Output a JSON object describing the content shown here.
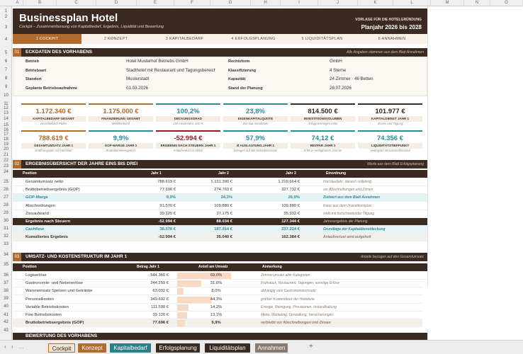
{
  "columns": [
    "A",
    "B",
    "C",
    "D",
    "E",
    "F",
    "G",
    "H",
    "I",
    "J",
    "K",
    "L",
    "M",
    "N",
    "O"
  ],
  "rows": [
    "1",
    "2",
    "3",
    "4",
    "5",
    "6",
    "7",
    "8",
    "9",
    "10",
    "11",
    "12",
    "13",
    "14",
    "15",
    "16",
    "17",
    "18",
    "19",
    "20",
    "21",
    "22",
    "23",
    "24",
    "25",
    "26",
    "27",
    "28",
    "29",
    "30",
    "31",
    "32",
    "33",
    "34",
    "35",
    "36",
    "37",
    "38",
    "39",
    "40",
    "41",
    "42",
    "43"
  ],
  "banner": {
    "title": "Businessplan Hotel",
    "subtitle": "Cockpit – Zusammenfassung von Kapitalbedarf, Ergebnis, Liquidität und Bewertung",
    "template_label": "VORLAGE FÜR DIE HOTELGRÜNDUNG",
    "plan_years": "Planjahr 2026 bis 2028"
  },
  "nav": [
    "1 COCKPIT",
    "2 KONZEPT",
    "3 KAPITALBEDARF",
    "4 ERFOLGSPLANUNG",
    "5 LIQUIDITÄTSPLAN",
    "6 ANNAHMEN"
  ],
  "section1": {
    "num": "01",
    "title": "ECKDATEN DES VORHABENS",
    "note": "Alle Angaben stammen aus dem Blatt Annahmen",
    "left": [
      {
        "label": "Betrieb",
        "value": "Hotel Musterhof Betriebs GmbH"
      },
      {
        "label": "Betriebsart",
        "value": "Stadthotel mit Restaurant und Tagungsbereich"
      },
      {
        "label": "Standort",
        "value": "Musterstadt"
      },
      {
        "label": "Geplante Betriebsaufnahme",
        "value": "01.03.2026"
      }
    ],
    "right": [
      {
        "label": "Rechtsform",
        "value": "GmbH"
      },
      {
        "label": "Klassifizierung",
        "value": "4 Sterne"
      },
      {
        "label": "Kapazität",
        "value": "24 Zimmer · 46 Betten"
      },
      {
        "label": "Stand der Planung",
        "value": "28.07.2026"
      }
    ]
  },
  "kpis_row1": [
    {
      "value": "1.172.340 €",
      "label": "KAPITALBEDARF GESAMT",
      "sub": "einschließlich Puffer",
      "color": "#b06b2e"
    },
    {
      "value": "1.175.000 €",
      "label": "FINANZIERUNG GESAMT",
      "sub": "Mittelherkunft",
      "color": "#b06b2e"
    },
    {
      "value": "100,2%",
      "label": "DECKUNGSGRAD",
      "sub": "Ziel mindestens 100 %",
      "color": "#2d8a9b"
    },
    {
      "value": "23,8%",
      "label": "EIGENKAPITALQUOTE",
      "sub": "Ziel laut Annahmen",
      "color": "#2d8a9b"
    },
    {
      "value": "814.500 €",
      "label": "INVESTITIONSVOLUMEN",
      "sub": "Anlagevermögen netto",
      "color": "#3a2a21"
    },
    {
      "value": "101.977 €",
      "label": "KAPITALDIENST JAHR 1",
      "sub": "Zinsen und Tilgung",
      "color": "#3a2a21"
    }
  ],
  "kpis_row2": [
    {
      "value": "788.619 €",
      "label": "GESAMTUMSATZ JAHR 1",
      "sub": "Eröffnungsjahr mit Hochlauf",
      "color": "#b06b2e"
    },
    {
      "value": "9,9%",
      "label": "GOP-MARGE JAHR 1",
      "sub": "Bruttobetriebsergebnis",
      "color": "#2d8a9b"
    },
    {
      "value": "-52.994 €",
      "label": "ERGEBNIS NACH STEUERN JAHR 1",
      "sub": "Anlaufverlust ist üblich",
      "color": "#8a1f2b"
    },
    {
      "value": "57,9%",
      "label": "Ø AUSLASTUNG JAHR 1",
      "sub": "bezogen auf alle Betriebsmonate",
      "color": "#2d8a9b"
    },
    {
      "value": "74,12 €",
      "label": "REVPAR JAHR 1",
      "sub": "Erlös je verfügbarem Zimmer",
      "color": "#2d8a9b"
    },
    {
      "value": "74.356 €",
      "label": "LIQUIDITÄTSTIEFPUNKT",
      "sub": "niedrigster Monatsendbestand",
      "color": "#2d8a9b"
    }
  ],
  "section2": {
    "num": "02",
    "title": "ERGEBNISÜBERSICHT DER JAHRE EINS BIS DREI",
    "note": "Werte aus dem Blatt Erfolgsplanung",
    "headers": [
      "Position",
      "Jahr 1",
      "Jahr 2",
      "Jahr 3",
      "Einordnung"
    ],
    "rows": [
      {
        "label": "Gesamtumsatz netto",
        "y1": "788.619 €",
        "y2": "1.131.390 €",
        "y3": "1.219.664 €",
        "note": "Hochlaufjahr, danach volljährig",
        "style": ""
      },
      {
        "label": "Bruttobetriebsergebnis (GOP)",
        "y1": "77.696 €",
        "y2": "274.763 €",
        "y3": "327.732 €",
        "note": "vor Abschreibungen und Zinsen",
        "style": ""
      },
      {
        "label": "GOP-Marge",
        "y1": "9,9%",
        "y2": "24,3%",
        "y3": "26,9%",
        "note": "Zielwert aus dem Blatt Annahmen",
        "style": "hl"
      },
      {
        "label": "Abschreibungen",
        "y1": "91.570 €",
        "y2": "109.880 €",
        "y3": "109.880 €",
        "note": "linear aus dem Investitionsplan",
        "style": ""
      },
      {
        "label": "Zinsaufwand",
        "y1": "39.120 €",
        "y2": "37.175 €",
        "y3": "35.932 €",
        "note": "sinkt mit fortschreitender Tilgung",
        "style": ""
      },
      {
        "label": "Ergebnis nach Steuern",
        "y1": "-52.994 €",
        "y2": "88.034 €",
        "y3": "127.344 €",
        "note": "Jahresergebnis der Planung",
        "style": "dark"
      },
      {
        "label": "Cashflow",
        "y1": "38.576 €",
        "y2": "197.914 €",
        "y3": "237.224 €",
        "note": "Grundlage der Kapitaldienstdeckung",
        "style": "hl"
      },
      {
        "label": "Kumuliertes Ergebnis",
        "y1": "-52.994 €",
        "y2": "35.040 €",
        "y3": "162.384 €",
        "note": "Anlaufverlust wird aufgeholt",
        "style": "gray"
      }
    ]
  },
  "section3": {
    "num": "03",
    "title": "UMSATZ- UND KOSTENSTRUKTUR IM JAHR 1",
    "note": "Anteile bezogen auf den Gesamtumsatz",
    "headers": [
      "Position",
      "Betrag Jahr 1",
      "Anteil am Umsatz",
      "Anmerkung"
    ],
    "rows": [
      {
        "label": "Logiserlöse",
        "amount": "544.360 €",
        "share": "69,0%",
        "pct": 69.0,
        "note": "Zimmerumsatz aller Kategorien",
        "style": ""
      },
      {
        "label": "Gastronomie- und Nebenerlöse",
        "amount": "244.259 €",
        "share": "31,0%",
        "pct": 31.0,
        "note": "Frühstück, Restaurant, Tagungen, sonstige Erlöse",
        "style": ""
      },
      {
        "label": "Wareneinsatz Speisen und Getränke",
        "amount": "63.032 €",
        "share": "8,0%",
        "pct": 8.0,
        "note": "abhängig vom Gastronomieumsatz",
        "style": ""
      },
      {
        "label": "Personalkosten",
        "amount": "349.692 €",
        "share": "44,3%",
        "pct": 44.3,
        "note": "größter Kostenblock der Hotellerie",
        "style": ""
      },
      {
        "label": "Variable Betriebskosten",
        "amount": "111.599 €",
        "share": "14,2%",
        "pct": 14.2,
        "note": "Energie, Reinigung, Provisionen, Instandhaltung",
        "style": ""
      },
      {
        "label": "Fixe Betriebskosten",
        "amount": "39.120 €",
        "share": "13,1%",
        "pct": 13.1,
        "note": "Miete, Marketing, Verwaltung, Versicherungen",
        "style": ""
      },
      {
        "label": "Bruttobetriebsergebnis (GOP)",
        "amount": "77.696 €",
        "share": "9,9%",
        "pct": 9.9,
        "note": "verbleibt vor Abschreibungen und Zinsen",
        "style": "gray"
      }
    ]
  },
  "section4_title": "BEWERTUNG DES VORHABENS",
  "tabs": [
    {
      "label": "Cockpit",
      "bg": "#f1e4d0",
      "fg": "#3a2a21"
    },
    {
      "label": "Konzept",
      "bg": "#b06b2e",
      "fg": "#ffffff"
    },
    {
      "label": "Kapitalbedarf",
      "bg": "#2d7e8b",
      "fg": "#ffffff"
    },
    {
      "label": "Erfolgsplanung",
      "bg": "#3a2a21",
      "fg": "#ffffff"
    },
    {
      "label": "Liquiditätsplan",
      "bg": "#3a2a21",
      "fg": "#ffffff"
    },
    {
      "label": "Annahmen",
      "bg": "#8a7a6d",
      "fg": "#ffffff"
    }
  ],
  "add_sheet": "+",
  "colors": {
    "dark": "#3a2a21",
    "accent": "#b06b2e",
    "teal": "#2d8a9b",
    "negative": "#8a1f2b"
  }
}
